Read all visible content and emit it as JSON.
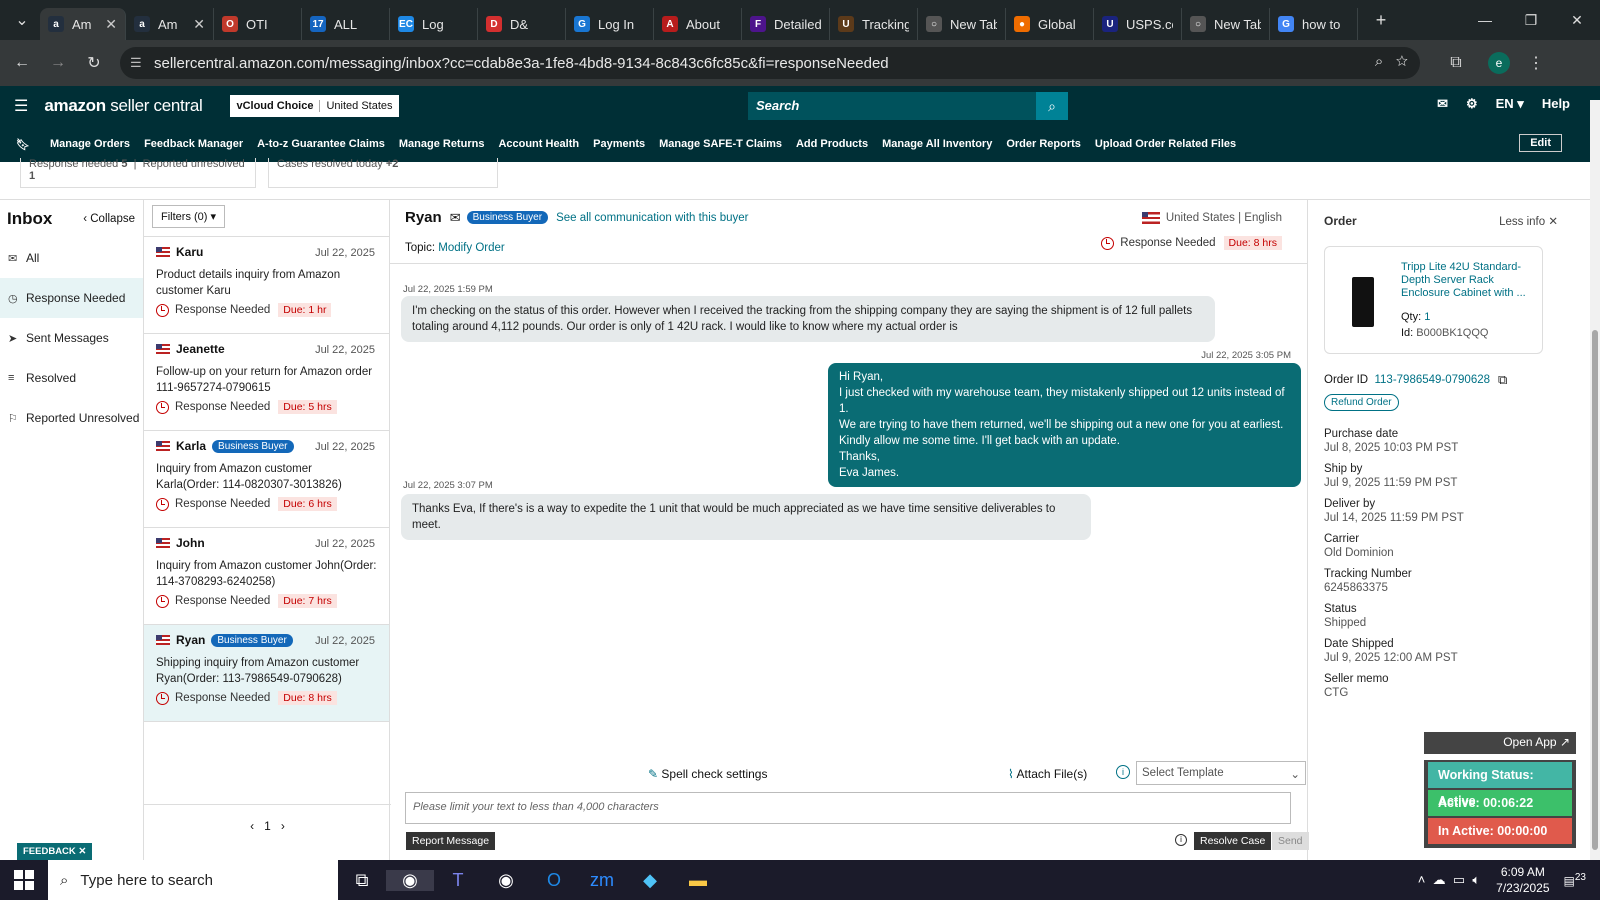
{
  "browser": {
    "tabs": [
      {
        "label": "Am",
        "icon": "amazon-icon",
        "color": "#232f3e",
        "glyph": "a",
        "active": true
      },
      {
        "label": "Am",
        "icon": "amazon-icon",
        "color": "#232f3e",
        "glyph": "a"
      },
      {
        "label": "OTI",
        "icon": "oti-icon",
        "color": "#c0392b",
        "glyph": "O"
      },
      {
        "label": "ALL",
        "icon": "17track-icon",
        "color": "#1565c0",
        "glyph": "17"
      },
      {
        "label": "Log",
        "icon": "ec-icon",
        "color": "#1e88e5",
        "glyph": "EC"
      },
      {
        "label": "D&",
        "icon": "dh-icon",
        "color": "#d32f2f",
        "glyph": "D"
      },
      {
        "label": "Log In",
        "icon": "g-icon",
        "color": "#1976d2",
        "glyph": "G"
      },
      {
        "label": "About",
        "icon": "about-icon",
        "color": "#b71c1c",
        "glyph": "A"
      },
      {
        "label": "Detailed",
        "icon": "fedex-icon",
        "color": "#4d148c",
        "glyph": "F"
      },
      {
        "label": "Tracking",
        "icon": "ups-icon",
        "color": "#5c3a1a",
        "glyph": "U"
      },
      {
        "label": "New Tab",
        "icon": "chrome-icon",
        "color": "#555",
        "glyph": "○"
      },
      {
        "label": "Global",
        "icon": "global-icon",
        "color": "#ef6c00",
        "glyph": "●"
      },
      {
        "label": "USPS.com",
        "icon": "usps-icon",
        "color": "#1a237e",
        "glyph": "U"
      },
      {
        "label": "New Tab",
        "icon": "chrome-icon",
        "color": "#555",
        "glyph": "○"
      },
      {
        "label": "how to",
        "icon": "google-icon",
        "color": "#4285f4",
        "glyph": "G"
      }
    ],
    "url": "sellercentral.amazon.com/messaging/inbox?cc=cdab8e3a-1fe8-4bd8-9134-8c843c6fc85c&fi=responseNeeded",
    "profile_initial": "e"
  },
  "header": {
    "logo": "amazon",
    "logo_suffix": "seller central",
    "store_brand": "vCloud Choice",
    "store_region": "United States",
    "search_placeholder": "Search",
    "lang": "EN",
    "help": "Help"
  },
  "menu": {
    "items": [
      "Manage Orders",
      "Feedback Manager",
      "A-to-z Guarantee Claims",
      "Manage Returns",
      "Account Health",
      "Payments",
      "Manage SAFE-T Claims",
      "Add Products",
      "Manage All Inventory",
      "Order Reports",
      "Upload Order Related Files"
    ],
    "edit": "Edit"
  },
  "stats": {
    "response_needed_label": "Response needed",
    "response_needed_count": "5",
    "reported_unresolved_label": "Reported unresolved",
    "reported_unresolved_count": "1",
    "cases_resolved_label": "Cases resolved today",
    "cases_resolved_count": "+2"
  },
  "inbox": {
    "title": "Inbox",
    "collapse": "Collapse",
    "filters": "Filters (0)",
    "nav": [
      "All",
      "Response Needed",
      "Sent Messages",
      "Resolved",
      "Reported Unresolved"
    ],
    "page": "1"
  },
  "conversations": [
    {
      "name": "Karu",
      "business": false,
      "date": "Jul 22, 2025",
      "subject": "Product details inquiry from Amazon customer Karu",
      "status": "Response Needed",
      "due": "Due: 1 hr"
    },
    {
      "name": "Jeanette",
      "business": false,
      "date": "Jul 22, 2025",
      "subject": "Follow-up on your return for Amazon order 111-9657274-0790615",
      "status": "Response Needed",
      "due": "Due: 5 hrs"
    },
    {
      "name": "Karla",
      "business": true,
      "date": "Jul 22, 2025",
      "subject": "Inquiry from Amazon customer Karla(Order: 114-0820307-3013826)",
      "status": "Response Needed",
      "due": "Due: 6 hrs"
    },
    {
      "name": "John",
      "business": false,
      "date": "Jul 22, 2025",
      "subject": "Inquiry from Amazon customer John(Order: 114-3708293-6240258)",
      "status": "Response Needed",
      "due": "Due: 7 hrs"
    },
    {
      "name": "Ryan",
      "business": true,
      "date": "Jul 22, 2025",
      "subject": "Shipping inquiry from Amazon customer Ryan(Order: 113-7986549-0790628)",
      "status": "Response Needed",
      "due": "Due: 8 hrs",
      "selected": true
    }
  ],
  "business_buyer_label": "Business Buyer",
  "chat": {
    "buyer": "Ryan",
    "see_all": "See all communication with this buyer",
    "country": "United States",
    "language": "English",
    "topic_label": "Topic:",
    "topic": "Modify Order",
    "status": "Response Needed",
    "due": "Due: 8 hrs",
    "messages": [
      {
        "dir": "in",
        "time": "Jul 22, 2025 1:59 PM",
        "lines": [
          "I'm checking on the status of this order. However when I received the tracking from the shipping company they are saying the shipment is of 12 full pallets",
          "totaling around 4,112 pounds. Our order is only of 1 42U rack. I would like to know where my actual order is"
        ]
      },
      {
        "dir": "out",
        "time": "Jul 22, 2025 3:05 PM",
        "lines": [
          "Hi Ryan,",
          "I just checked with my warehouse team, they mistakenly shipped out 12 units instead of 1.",
          "We are trying to have them returned, we'll be shipping out a new one for you at earliest.",
          "Kindly allow me some time. I'll get back with an update.",
          "Thanks,",
          "Eva James."
        ]
      },
      {
        "dir": "in",
        "time": "Jul 22, 2025 3:07 PM",
        "lines": [
          "Thanks Eva, If there's is a way to expedite the 1 unit that would be much appreciated as we have time sensitive deliverables to meet."
        ]
      }
    ],
    "spell_check": "Spell check settings",
    "attach": "Attach File(s)",
    "template": "Select Template",
    "composer_placeholder": "Please limit your text to less than 4,000 characters",
    "report": "Report Message",
    "resolve": "Resolve Case",
    "send": "Send"
  },
  "order": {
    "title": "Order",
    "less_info": "Less info",
    "product": "Tripp Lite 42U Standard-Depth Server Rack Enclosure Cabinet with ...",
    "qty_label": "Qty:",
    "qty": "1",
    "id_label": "Id:",
    "asin": "B000BK1QQQ",
    "order_id_label": "Order ID",
    "order_id": "113-7986549-0790628",
    "refund": "Refund Order",
    "fields": [
      {
        "label": "Purchase date",
        "value": "Jul 8, 2025 10:03 PM PST"
      },
      {
        "label": "Ship by",
        "value": "Jul 9, 2025 11:59 PM PST"
      },
      {
        "label": "Deliver by",
        "value": "Jul 14, 2025 11:59 PM PST"
      },
      {
        "label": "Carrier",
        "value": "Old Dominion"
      },
      {
        "label": "Tracking Number",
        "value": "6245863375"
      },
      {
        "label": "Status",
        "value": "Shipped"
      },
      {
        "label": "Date Shipped",
        "value": "Jul 9, 2025 12:00 AM PST"
      },
      {
        "label": "Seller memo",
        "value": "CTG"
      }
    ]
  },
  "widget": {
    "open_app": "Open App",
    "working": "Working Status: Active",
    "active": "Active: 00:06:22",
    "inactive": "In Active: 00:00:00",
    "colors": {
      "working": "#43b6a5",
      "active": "#3cc06a",
      "inactive": "#e05a4c"
    }
  },
  "feedback": "FEEDBACK",
  "taskbar": {
    "search": "Type here to search",
    "time": "6:09 AM",
    "date": "7/23/2025",
    "notif": "23"
  }
}
